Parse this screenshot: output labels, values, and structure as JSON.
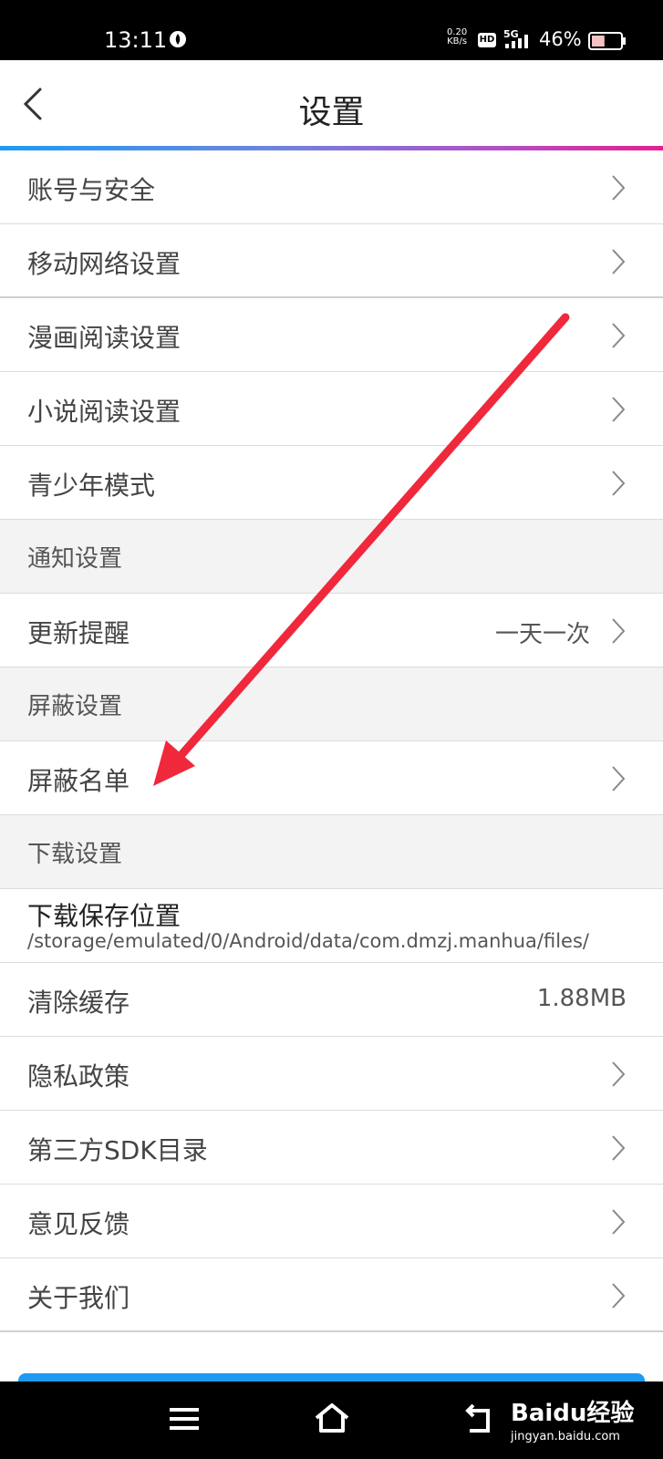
{
  "status_bar": {
    "time": "13:11",
    "net_speed_top": "0.20",
    "net_speed_bottom": "KB/s",
    "hd_badge": "HD",
    "network": "5G",
    "battery_percent": "46%",
    "battery_level": 0.46
  },
  "header": {
    "title": "设置"
  },
  "settings": {
    "rows": [
      {
        "label": "账号与安全"
      },
      {
        "label": "移动网络设置"
      },
      {
        "label": "漫画阅读设置"
      },
      {
        "label": "小说阅读设置"
      },
      {
        "label": "青少年模式"
      },
      {
        "label": "通知设置"
      },
      {
        "label": "更新提醒",
        "value": "一天一次"
      },
      {
        "label": "屏蔽设置"
      },
      {
        "label": "屏蔽名单"
      },
      {
        "label": "下载设置"
      },
      {
        "label": "下载保存位置",
        "value": "/storage/emulated/0/Android/data/com.dmzj.manhua/files/"
      },
      {
        "label": "清除缓存",
        "value": "1.88MB"
      },
      {
        "label": "隐私政策"
      },
      {
        "label": "第三方SDK目录"
      },
      {
        "label": "意见反馈"
      },
      {
        "label": "关于我们"
      }
    ]
  },
  "watermark": {
    "logo": "Baidu经验",
    "site": "jingyan.baidu.com"
  },
  "colors": {
    "accent_blue": "#1e9bf0",
    "accent_pink": "#e81e8c",
    "annotation_red": "#f0283c",
    "section_bg": "#f3f3f3"
  }
}
